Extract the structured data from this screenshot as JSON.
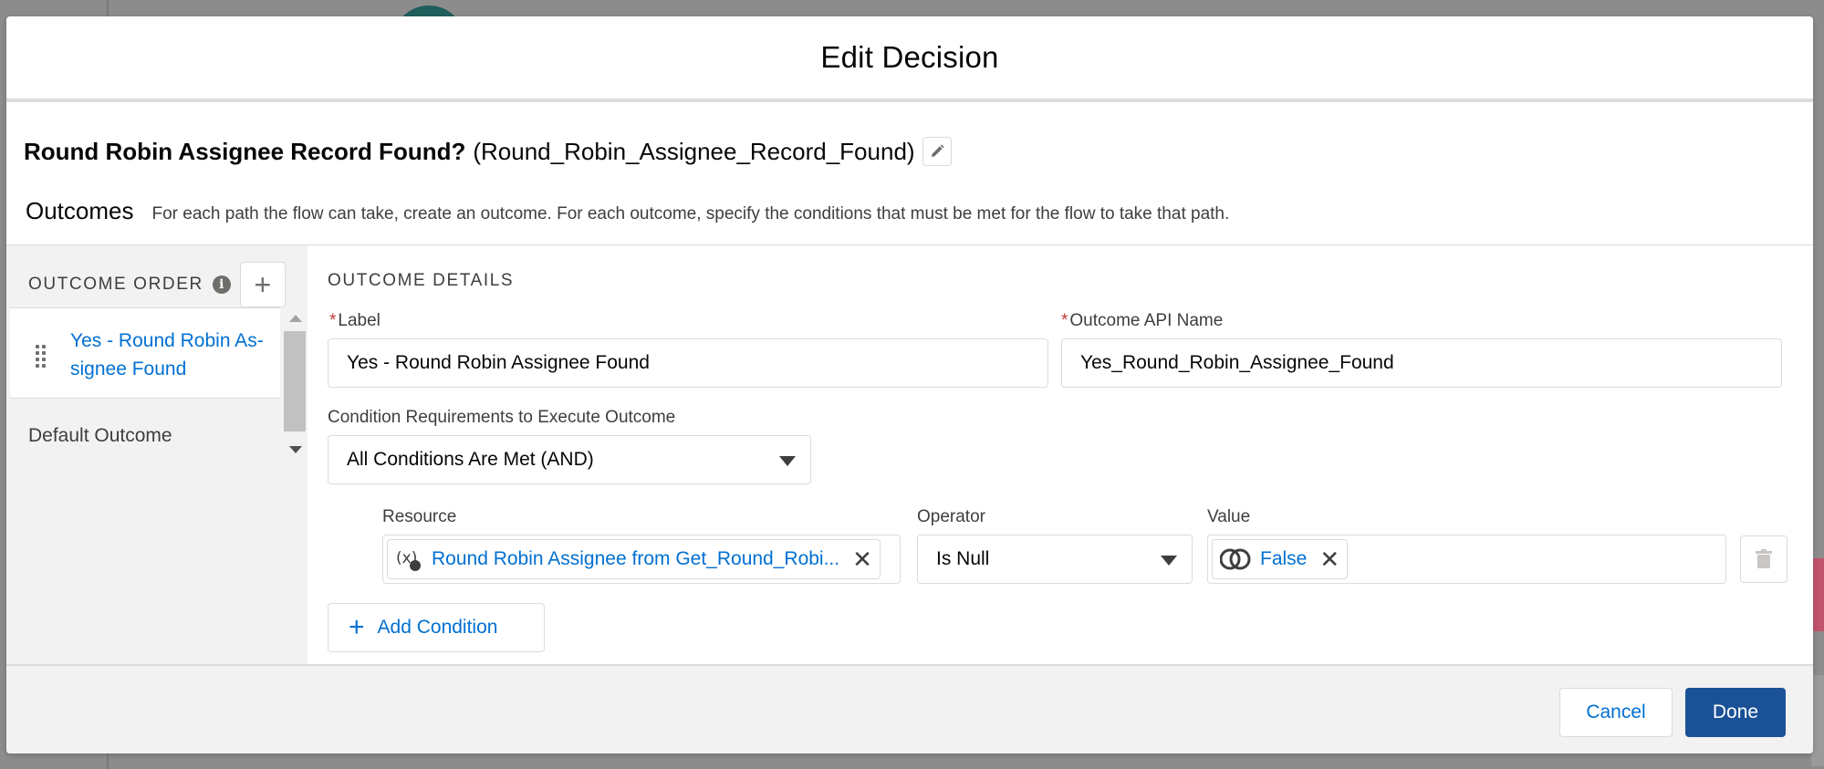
{
  "modal": {
    "title": "Edit Decision"
  },
  "decision": {
    "label": "Round Robin Assignee Record Found?",
    "api_name": "(Round_Robin_Assignee_Record_Found)"
  },
  "outcomes": {
    "title": "Outcomes",
    "help_text": "For each path the flow can take, create an outcome. For each outcome, specify the conditions that must be met for the flow to take that path."
  },
  "sidebar": {
    "heading": "OUTCOME ORDER",
    "info_icon": "i",
    "add_icon": "+",
    "items": [
      {
        "label": "Yes - Round Robin As- signee Found",
        "active": true
      },
      {
        "label": "Default Outcome",
        "active": false
      }
    ]
  },
  "details": {
    "heading": "OUTCOME DETAILS",
    "label_field": {
      "label": "Label",
      "required_marker": "*",
      "value": "Yes - Round Robin Assignee Found"
    },
    "api_name_field": {
      "label": "Outcome API Name",
      "required_marker": "*",
      "value": "Yes_Round_Robin_Assignee_Found"
    },
    "condition_requirements": {
      "label": "Condition Requirements to Execute Outcome",
      "value": "All Conditions Are Met (AND)"
    },
    "condition": {
      "resource_label": "Resource",
      "resource_value": "Round Robin Assignee from Get_Round_Robi...",
      "operator_label": "Operator",
      "operator_value": "Is Null",
      "value_label": "Value",
      "value_value": "False",
      "close_glyph": "✕"
    },
    "add_condition_plus": "+",
    "add_condition_label": "Add Condition"
  },
  "footer": {
    "cancel_label": "Cancel",
    "done_label": "Done"
  },
  "colors": {
    "link": "#0070d2",
    "brand_button": "#1b5297",
    "required": "#c23934"
  }
}
